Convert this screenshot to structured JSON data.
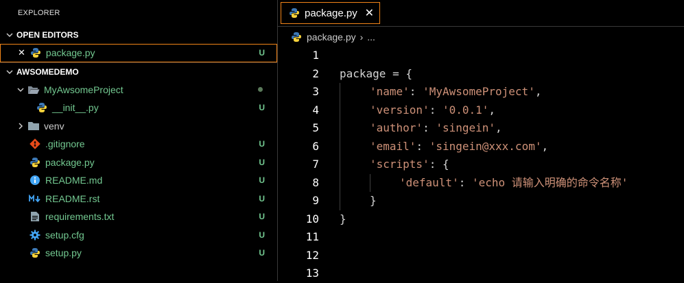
{
  "explorer": {
    "title": "EXPLORER",
    "open_editors": {
      "header": "OPEN EDITORS",
      "items": [
        {
          "close": "✕",
          "name": "package.py",
          "status": "U"
        }
      ]
    },
    "project": {
      "header": "AWSOMEDEMO",
      "items": [
        {
          "name": "MyAwsomeProject",
          "status": ""
        },
        {
          "name": "__init__.py",
          "status": "U"
        },
        {
          "name": "venv",
          "status": ""
        },
        {
          "name": ".gitignore",
          "status": "U"
        },
        {
          "name": "package.py",
          "status": "U"
        },
        {
          "name": "README.md",
          "status": "U"
        },
        {
          "name": "README.rst",
          "status": "U"
        },
        {
          "name": "requirements.txt",
          "status": "U"
        },
        {
          "name": "setup.cfg",
          "status": "U"
        },
        {
          "name": "setup.py",
          "status": "U"
        }
      ]
    }
  },
  "editor": {
    "tab": {
      "label": "package.py",
      "close": "✕"
    },
    "breadcrumb": {
      "file": "package.py",
      "sep": "›",
      "rest": "..."
    },
    "line_numbers": [
      "1",
      "2",
      "3",
      "4",
      "5",
      "6",
      "7",
      "8",
      "9",
      "10",
      "11",
      "12",
      "13"
    ],
    "code": {
      "l2": {
        "a": "package = {"
      },
      "l3": {
        "k": "'name'",
        "c": ": ",
        "v": "'MyAwsomeProject'",
        "e": ","
      },
      "l4": {
        "k": "'version'",
        "c": ": ",
        "v": "'0.0.1'",
        "e": ","
      },
      "l5": {
        "k": "'author'",
        "c": ": ",
        "v": "'singein'",
        "e": ","
      },
      "l6": {
        "k": "'email'",
        "c": ": ",
        "v": "'singein@xxx.com'",
        "e": ","
      },
      "l7": {
        "k": "'scripts'",
        "c": ": {"
      },
      "l8": {
        "k": "'default'",
        "c": ": ",
        "v": "'echo 请输入明确的命令名称'"
      },
      "l9": {
        "a": "}"
      },
      "l10": {
        "a": "}"
      }
    }
  },
  "colors": {
    "modified": "#73c991",
    "string": "#ce9178",
    "focus_border": "#f38518"
  }
}
